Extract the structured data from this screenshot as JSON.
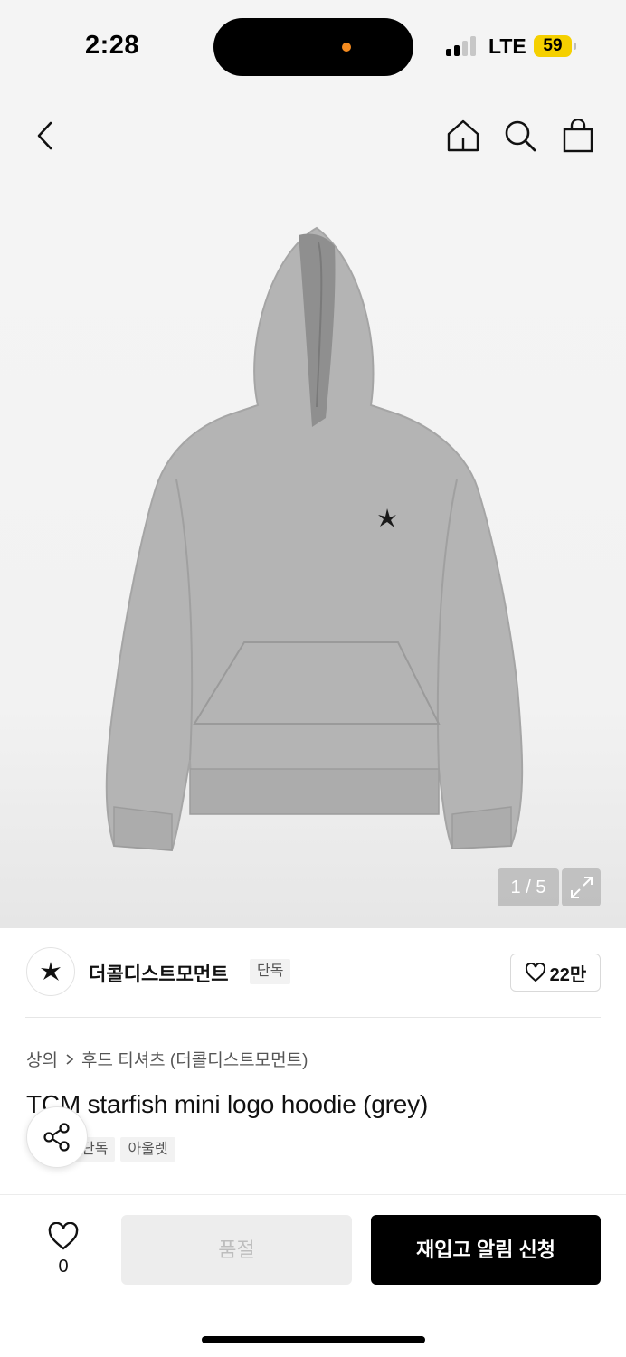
{
  "status_bar": {
    "time": "2:28",
    "network": "LTE",
    "battery": "59",
    "battery_color": "#f5d000"
  },
  "nav": {
    "back_icon": "chevron-left-icon",
    "home_icon": "home-icon",
    "search_icon": "search-icon",
    "cart_icon": "shopping-bag-icon"
  },
  "gallery": {
    "page_indicator": "1 / 5",
    "expand_icon": "expand-icon"
  },
  "brand": {
    "name": "더콜디스트모먼트",
    "exclusive_label": "단독",
    "likes": "22만"
  },
  "product": {
    "breadcrumb": [
      "상의",
      "후드 티셔츠 (더콜디스트모먼트)"
    ],
    "title": "TCM starfish mini logo hoodie (grey)",
    "tags": [
      "단독",
      "아울렛"
    ]
  },
  "bottom_bar": {
    "wish_count": "0",
    "soldout_label": "품절",
    "restock_label": "재입고 알림 신청"
  }
}
